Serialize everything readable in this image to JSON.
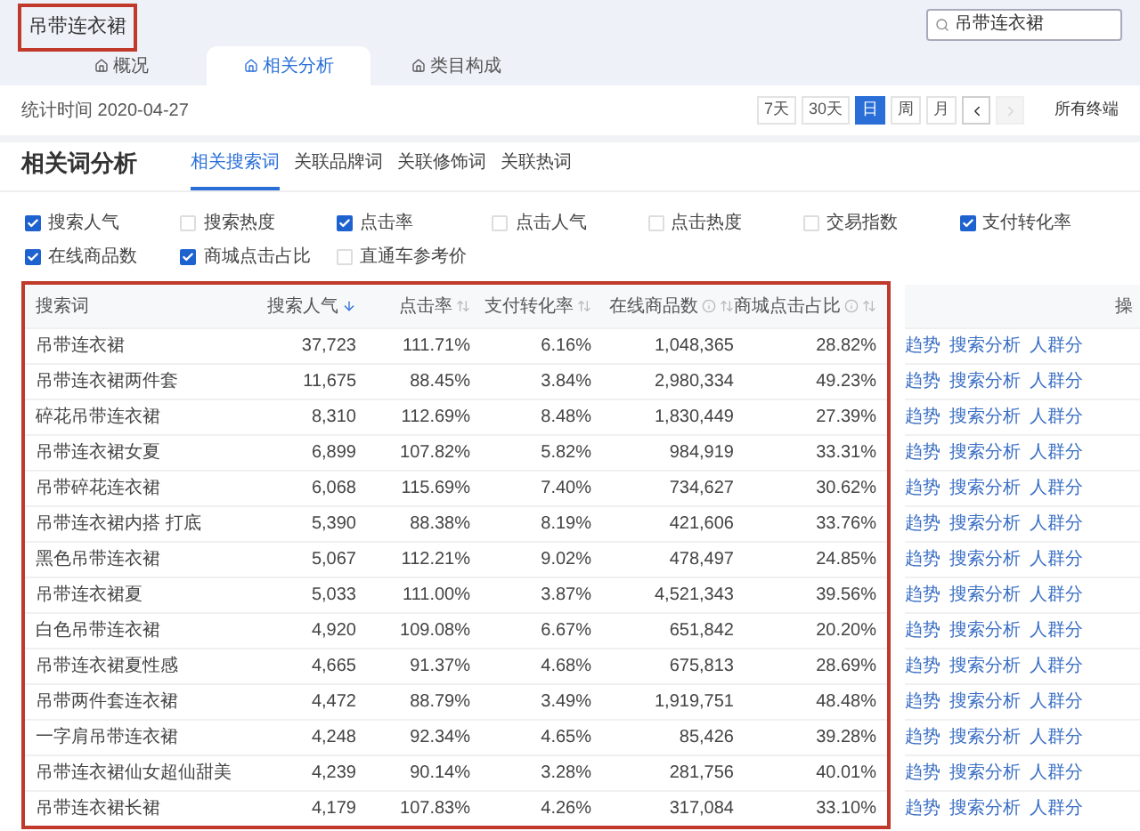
{
  "title": {
    "text": "吊带连衣裙",
    "highlighted": true
  },
  "search": {
    "value": "吊带连衣裙"
  },
  "tabs": [
    {
      "label": "概况",
      "selected": false
    },
    {
      "label": "相关分析",
      "selected": true
    },
    {
      "label": "类目构成",
      "selected": false
    }
  ],
  "stats_time": "统计时间 2020-04-27",
  "periods": [
    {
      "label": "7天",
      "selected": false
    },
    {
      "label": "30天",
      "selected": false
    },
    {
      "label": "日",
      "selected": true
    },
    {
      "label": "周",
      "selected": false
    },
    {
      "label": "月",
      "selected": false
    }
  ],
  "nav": [
    {
      "kind": "prev",
      "disabled": false
    },
    {
      "kind": "next",
      "disabled": true
    }
  ],
  "terminal": "所有终端",
  "section": {
    "title": "相关词分析",
    "tabs": [
      {
        "label": "相关搜索词",
        "selected": true
      },
      {
        "label": "关联品牌词",
        "selected": false
      },
      {
        "label": "关联修饰词",
        "selected": false
      },
      {
        "label": "关联热词",
        "selected": false
      }
    ]
  },
  "metrics": [
    {
      "label": "搜索人气",
      "checked": true
    },
    {
      "label": "搜索热度",
      "checked": false
    },
    {
      "label": "点击率",
      "checked": true
    },
    {
      "label": "点击人气",
      "checked": false
    },
    {
      "label": "点击热度",
      "checked": false
    },
    {
      "label": "交易指数",
      "checked": false
    },
    {
      "label": "支付转化率",
      "checked": true
    },
    {
      "label": "在线商品数",
      "checked": true
    },
    {
      "label": "商城点击占比",
      "checked": true
    },
    {
      "label": "直通车参考价",
      "checked": false
    }
  ],
  "table": {
    "highlighted": true,
    "columns": [
      {
        "label": "搜索词",
        "kind": "plain"
      },
      {
        "label": "搜索人气",
        "kind": "sorted"
      },
      {
        "label": "点击率",
        "kind": "sortable"
      },
      {
        "label": "支付转化率",
        "kind": "sortable"
      },
      {
        "label": "在线商品数",
        "kind": "described"
      },
      {
        "label": "商城点击占比",
        "kind": "described"
      }
    ],
    "action_column": "操",
    "rows": [
      {
        "cells": [
          "吊带连衣裙",
          "37,723",
          "111.71%",
          "6.16%",
          "1,048,365",
          "28.82%"
        ],
        "actions": [
          "趋势",
          "搜索分析",
          "人群分"
        ]
      },
      {
        "cells": [
          "吊带连衣裙两件套",
          "11,675",
          "88.45%",
          "3.84%",
          "2,980,334",
          "49.23%"
        ],
        "actions": [
          "趋势",
          "搜索分析",
          "人群分"
        ]
      },
      {
        "cells": [
          "碎花吊带连衣裙",
          "8,310",
          "112.69%",
          "8.48%",
          "1,830,449",
          "27.39%"
        ],
        "actions": [
          "趋势",
          "搜索分析",
          "人群分"
        ]
      },
      {
        "cells": [
          "吊带连衣裙女夏",
          "6,899",
          "107.82%",
          "5.82%",
          "984,919",
          "33.31%"
        ],
        "actions": [
          "趋势",
          "搜索分析",
          "人群分"
        ]
      },
      {
        "cells": [
          "吊带碎花连衣裙",
          "6,068",
          "115.69%",
          "7.40%",
          "734,627",
          "30.62%"
        ],
        "actions": [
          "趋势",
          "搜索分析",
          "人群分"
        ]
      },
      {
        "cells": [
          "吊带连衣裙内搭 打底",
          "5,390",
          "88.38%",
          "8.19%",
          "421,606",
          "33.76%"
        ],
        "actions": [
          "趋势",
          "搜索分析",
          "人群分"
        ]
      },
      {
        "cells": [
          "黑色吊带连衣裙",
          "5,067",
          "112.21%",
          "9.02%",
          "478,497",
          "24.85%"
        ],
        "actions": [
          "趋势",
          "搜索分析",
          "人群分"
        ]
      },
      {
        "cells": [
          "吊带连衣裙夏",
          "5,033",
          "111.00%",
          "3.87%",
          "4,521,343",
          "39.56%"
        ],
        "actions": [
          "趋势",
          "搜索分析",
          "人群分"
        ]
      },
      {
        "cells": [
          "白色吊带连衣裙",
          "4,920",
          "109.08%",
          "6.67%",
          "651,842",
          "20.20%"
        ],
        "actions": [
          "趋势",
          "搜索分析",
          "人群分"
        ]
      },
      {
        "cells": [
          "吊带连衣裙夏性感",
          "4,665",
          "91.37%",
          "4.68%",
          "675,813",
          "28.69%"
        ],
        "actions": [
          "趋势",
          "搜索分析",
          "人群分"
        ]
      },
      {
        "cells": [
          "吊带两件套连衣裙",
          "4,472",
          "88.79%",
          "3.49%",
          "1,919,751",
          "48.48%"
        ],
        "actions": [
          "趋势",
          "搜索分析",
          "人群分"
        ]
      },
      {
        "cells": [
          "一字肩吊带连衣裙",
          "4,248",
          "92.34%",
          "4.65%",
          "85,426",
          "39.28%"
        ],
        "actions": [
          "趋势",
          "搜索分析",
          "人群分"
        ]
      },
      {
        "cells": [
          "吊带连衣裙仙女超仙甜美",
          "4,239",
          "90.14%",
          "3.28%",
          "281,756",
          "40.01%"
        ],
        "actions": [
          "趋势",
          "搜索分析",
          "人群分"
        ]
      },
      {
        "cells": [
          "吊带连衣裙长裙",
          "4,179",
          "107.83%",
          "4.26%",
          "317,084",
          "33.10%"
        ],
        "actions": [
          "趋势",
          "搜索分析",
          "人群分"
        ]
      }
    ]
  }
}
